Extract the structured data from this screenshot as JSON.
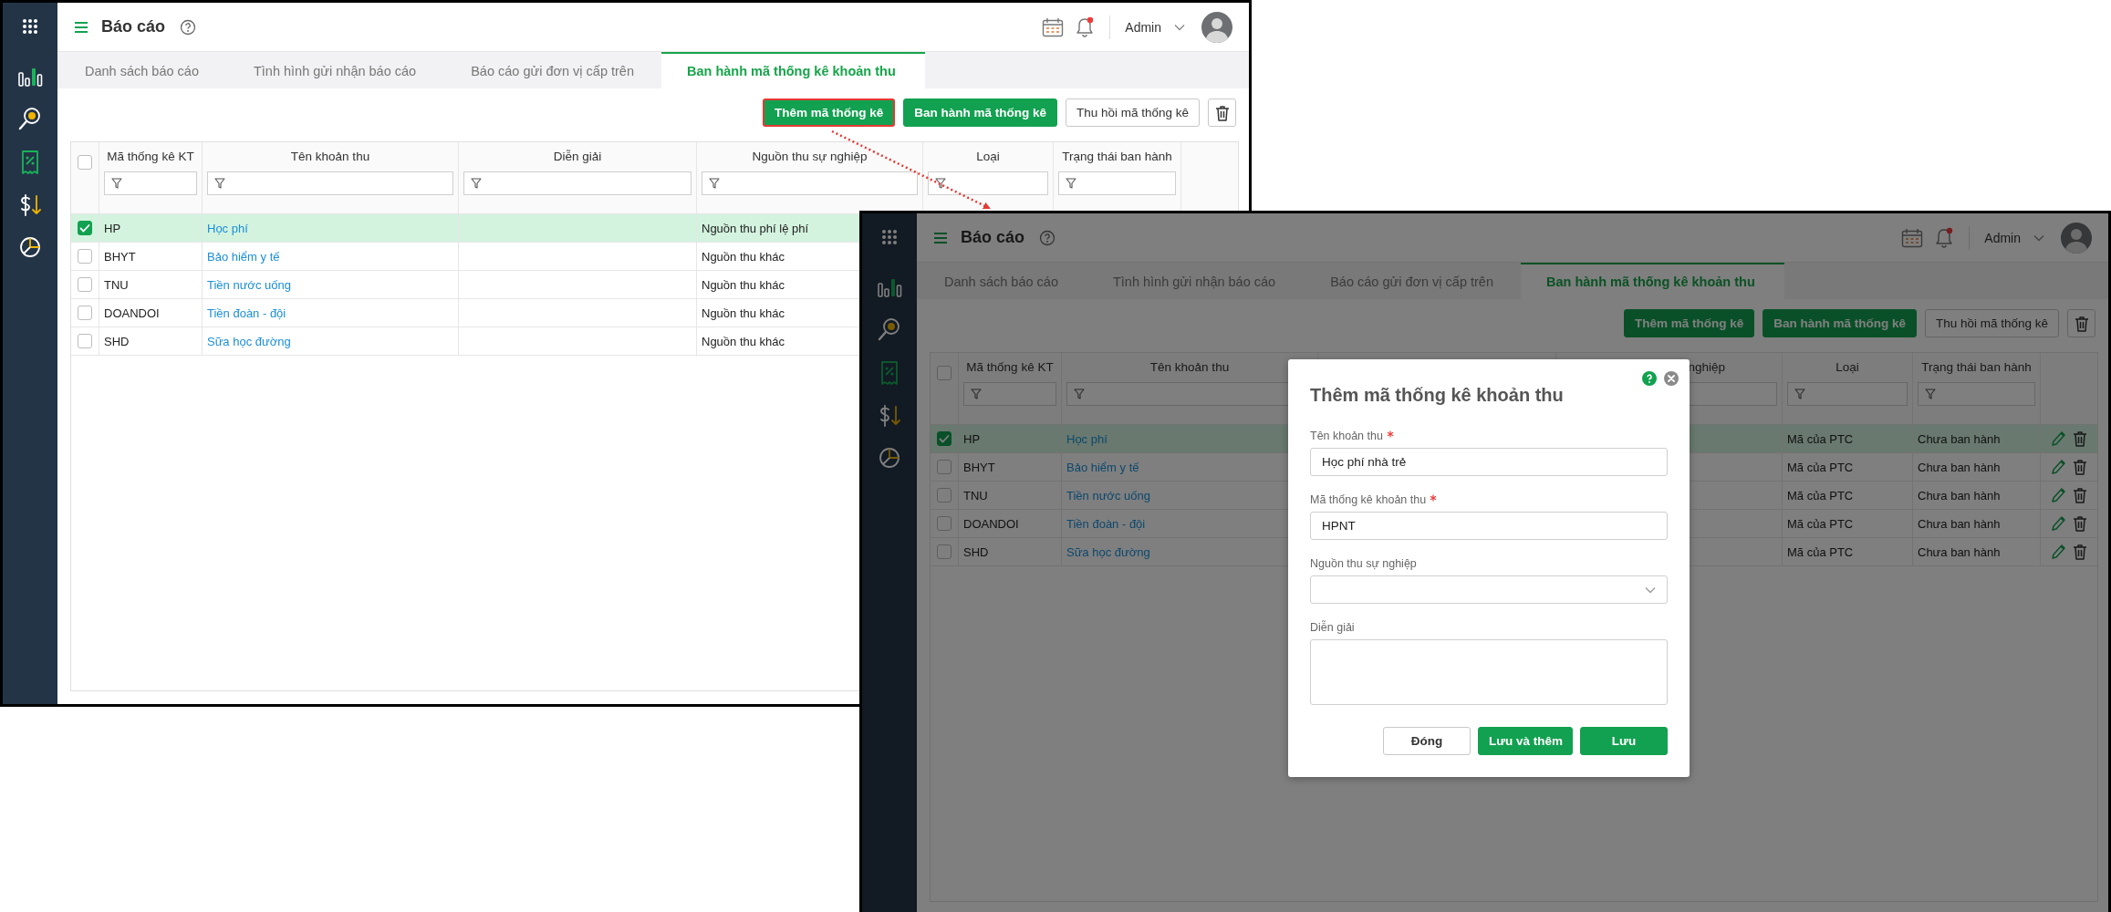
{
  "windows": [
    {
      "dimmed": false,
      "header": {
        "title": "Báo cáo",
        "user": "Admin",
        "notification": true
      },
      "tabs": [
        {
          "label": "Danh sách báo cáo",
          "selected": false
        },
        {
          "label": "Tình hình gửi nhận báo cáo",
          "selected": false
        },
        {
          "label": "Báo cáo gửi đơn vị cấp trên",
          "selected": false
        },
        {
          "label": "Ban hành mã thống kê khoản thu",
          "selected": true
        }
      ],
      "toolbar": [
        {
          "label": "Thêm mã thống kê",
          "kind": "primary",
          "highlighted": true
        },
        {
          "label": "Ban hành mã thống kê",
          "kind": "primary",
          "highlighted": false
        },
        {
          "label": "Thu hồi mã thống kê",
          "kind": "secondary",
          "highlighted": false
        },
        {
          "kind": "delete",
          "highlighted": false
        }
      ],
      "table": {
        "all_checked": false,
        "columns": [
          {
            "label": "Mã thống kê KT"
          },
          {
            "label": "Tên khoản thu"
          },
          {
            "label": "Diễn giải"
          },
          {
            "label": "Nguồn thu sự nghiệp"
          },
          {
            "label": "Loại"
          },
          {
            "label": "Trạng thái ban hành"
          }
        ],
        "rows": [
          {
            "selected": true,
            "code": "HP",
            "name": "Học phí",
            "source": "Nguồn thu phí lệ phí"
          },
          {
            "selected": false,
            "code": "BHYT",
            "name": "Bảo hiểm y tế",
            "source": "Nguồn thu khác"
          },
          {
            "selected": false,
            "code": "TNU",
            "name": "Tiền nước uống",
            "source": "Nguồn thu khác"
          },
          {
            "selected": false,
            "code": "DOANDOI",
            "name": "Tiền đoàn - đội",
            "source": "Nguồn thu khác"
          },
          {
            "selected": false,
            "code": "SHD",
            "name": "Sữa học đường",
            "source": "Nguồn thu khác"
          }
        ]
      }
    },
    {
      "dimmed": true,
      "header": {
        "title": "Báo cáo",
        "user": "Admin",
        "notification": true
      },
      "tabs": [
        {
          "label": "Danh sách báo cáo",
          "selected": false
        },
        {
          "label": "Tình hình gửi nhận báo cáo",
          "selected": false
        },
        {
          "label": "Báo cáo gửi đơn vị cấp trên",
          "selected": false
        },
        {
          "label": "Ban hành mã thống kê khoản thu",
          "selected": true
        }
      ],
      "toolbar": [
        {
          "label": "Thêm mã thống kê",
          "kind": "primary",
          "highlighted": false
        },
        {
          "label": "Ban hành mã thống kê",
          "kind": "primary",
          "highlighted": false
        },
        {
          "label": "Thu hồi mã thống kê",
          "kind": "secondary",
          "highlighted": false
        },
        {
          "kind": "delete",
          "highlighted": false
        }
      ],
      "table": {
        "all_checked": false,
        "columns": [
          {
            "label": "Mã thống kê KT"
          },
          {
            "label": "Tên khoản thu"
          },
          {},
          {
            "label": "nghiệp",
            "cut": true
          },
          {
            "label": "Loại"
          },
          {
            "label": "Trạng thái ban hành"
          }
        ],
        "rows": [
          {
            "selected": true,
            "code": "HP",
            "name": "Học phí",
            "type": "Mã của PTC",
            "status": "Chưa ban hành",
            "actions": true
          },
          {
            "selected": false,
            "code": "BHYT",
            "name": "Bảo hiểm y tế",
            "type": "Mã của PTC",
            "status": "Chưa ban hành",
            "actions": true
          },
          {
            "selected": false,
            "code": "TNU",
            "name": "Tiền nước uống",
            "type": "Mã của PTC",
            "status": "Chưa ban hành",
            "actions": true
          },
          {
            "selected": false,
            "code": "DOANDOI",
            "name": "Tiền đoàn - đội",
            "type": "Mã của PTC",
            "status": "Chưa ban hành",
            "actions": true
          },
          {
            "selected": false,
            "code": "SHD",
            "name": "Sữa học đường",
            "type": "Mã của PTC",
            "status": "Chưa ban hành",
            "actions": true
          }
        ]
      },
      "modal": {
        "title": "Thêm mã thống kê khoản thu",
        "fields": [
          {
            "label": "Tên khoản thu",
            "required": true,
            "kind": "text",
            "value": "Học phí nhà trẻ"
          },
          {
            "label": "Mã thống kê khoản thu",
            "required": true,
            "kind": "text",
            "value": "HPNT"
          },
          {
            "label": "Nguồn thu sự nghiệp",
            "required": false,
            "kind": "select"
          },
          {
            "label": "Diễn giải",
            "required": false,
            "kind": "textarea"
          }
        ],
        "buttons": [
          {
            "label": "Đóng",
            "kind": "secondary"
          },
          {
            "label": "Lưu và thêm",
            "kind": "primary"
          },
          {
            "label": "Lưu",
            "kind": "primary"
          }
        ]
      }
    }
  ]
}
